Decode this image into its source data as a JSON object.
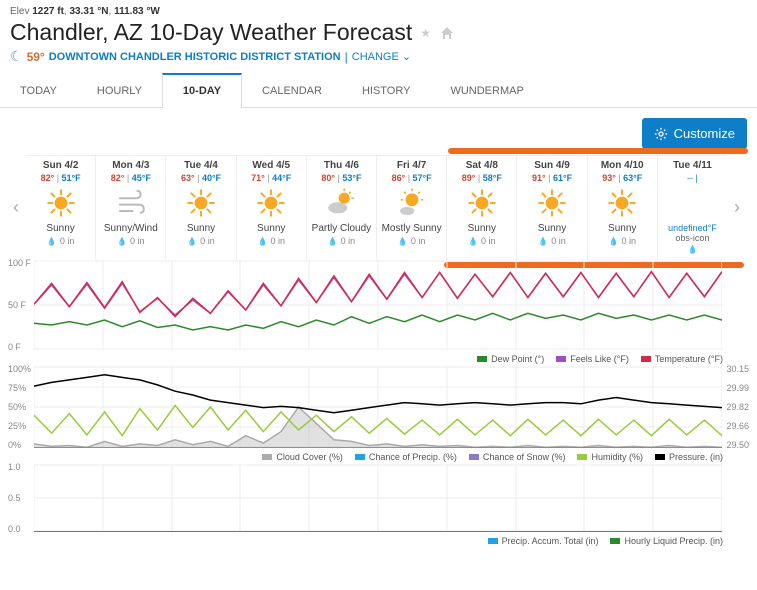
{
  "header": {
    "elev_label": "Elev",
    "elev": "1227 ft",
    "lat": "33.31 °N",
    "lon": "111.83 °W",
    "title": "Chandler, AZ 10-Day Weather Forecast",
    "current_temp": "59°",
    "station": "DOWNTOWN CHANDLER HISTORIC DISTRICT STATION",
    "change": "CHANGE"
  },
  "tabs": [
    "TODAY",
    "HOURLY",
    "10-DAY",
    "CALENDAR",
    "HISTORY",
    "WUNDERMAP"
  ],
  "active_tab": 2,
  "customize_label": "Customize",
  "days": [
    {
      "label": "Sun 4/2",
      "hi": "82°",
      "lo": "51°F",
      "icon": "sunny",
      "cond": "Sunny",
      "precip": "0 in"
    },
    {
      "label": "Mon 4/3",
      "hi": "82°",
      "lo": "45°F",
      "icon": "wind",
      "cond": "Sunny/Wind",
      "precip": "0 in"
    },
    {
      "label": "Tue 4/4",
      "hi": "63°",
      "lo": "40°F",
      "icon": "sunny",
      "cond": "Sunny",
      "precip": "0 in"
    },
    {
      "label": "Wed 4/5",
      "hi": "71°",
      "lo": "44°F",
      "icon": "sunny",
      "cond": "Sunny",
      "precip": "0 in"
    },
    {
      "label": "Thu 4/6",
      "hi": "80°",
      "lo": "53°F",
      "icon": "partly",
      "cond": "Partly Cloudy",
      "precip": "0 in"
    },
    {
      "label": "Fri 4/7",
      "hi": "86°",
      "lo": "57°F",
      "icon": "mostly",
      "cond": "Mostly Sunny",
      "precip": "0 in"
    },
    {
      "label": "Sat 4/8",
      "hi": "89°",
      "lo": "58°F",
      "icon": "sunny",
      "cond": "Sunny",
      "precip": "0 in"
    },
    {
      "label": "Sun 4/9",
      "hi": "91°",
      "lo": "61°F",
      "icon": "sunny",
      "cond": "Sunny",
      "precip": "0 in"
    },
    {
      "label": "Mon 4/10",
      "hi": "93°",
      "lo": "63°F",
      "icon": "sunny",
      "cond": "Sunny",
      "precip": "0 in"
    },
    {
      "label": "Tue 4/11",
      "hi": "--",
      "lo": "",
      "icon": "none",
      "cond": "obs-icon",
      "precip": "",
      "undefined": "undefined°F"
    }
  ],
  "chart_data": [
    {
      "type": "line",
      "ylabel_left": [
        "100 F",
        "50 F",
        "0 F"
      ],
      "series": [
        {
          "name": "Dew Point (°)",
          "color": "#2a8a2a",
          "values": [
            32,
            30,
            34,
            30,
            36,
            28,
            35,
            27,
            30,
            24,
            28,
            24,
            30,
            26,
            34,
            28,
            36,
            30,
            40,
            32,
            40,
            34,
            42,
            34,
            42,
            36,
            44,
            36,
            44,
            38,
            42,
            36,
            44,
            38,
            42,
            36,
            42,
            36,
            42,
            36
          ]
        },
        {
          "name": "Feels Like (°F)",
          "color": "#a050c0",
          "values": [
            55,
            78,
            52,
            79,
            50,
            80,
            46,
            62,
            42,
            60,
            44,
            70,
            48,
            78,
            53,
            84,
            57,
            87,
            58,
            89,
            61,
            91,
            63,
            93,
            62,
            91,
            64,
            93,
            63,
            92,
            64,
            93,
            63,
            92,
            64,
            94,
            63,
            92,
            64,
            94
          ]
        },
        {
          "name": "Temperature (°F)",
          "color": "#d6294a",
          "values": [
            55,
            80,
            52,
            81,
            51,
            82,
            45,
            63,
            40,
            62,
            44,
            71,
            48,
            80,
            53,
            86,
            57,
            89,
            58,
            91,
            61,
            93,
            63,
            93,
            62,
            91,
            64,
            93,
            63,
            92,
            64,
            93,
            63,
            92,
            64,
            94,
            63,
            92,
            64,
            94
          ]
        }
      ],
      "ylim": [
        0,
        108
      ]
    },
    {
      "type": "line",
      "ylabel_left": [
        "100%",
        "75%",
        "50%",
        "25%",
        "0%"
      ],
      "ylabel_right": [
        "30.15",
        "29.99",
        "29.82",
        "29.66",
        "29.50"
      ],
      "series": [
        {
          "name": "Cloud Cover (%)",
          "color": "#aaa",
          "area": true,
          "values": [
            5,
            2,
            3,
            1,
            8,
            2,
            5,
            3,
            10,
            4,
            8,
            2,
            15,
            6,
            20,
            50,
            30,
            10,
            8,
            3,
            5,
            2,
            4,
            2,
            3,
            1,
            2,
            1,
            3,
            1,
            2,
            1,
            3,
            1,
            2,
            1,
            3,
            1,
            2,
            1
          ]
        },
        {
          "name": "Chance of Precip. (%)",
          "color": "#1fa3e6",
          "values": [
            0,
            0,
            0,
            0,
            0,
            0,
            0,
            0,
            0,
            0,
            0,
            0,
            0,
            0,
            0,
            0,
            0,
            0,
            0,
            0,
            0,
            0,
            0,
            0,
            0,
            0,
            0,
            0,
            0,
            0,
            0,
            0,
            0,
            0,
            0,
            0,
            0,
            0,
            0,
            0
          ]
        },
        {
          "name": "Chance of Snow (%)",
          "color": "#8a7ac7",
          "values": [
            0,
            0,
            0,
            0,
            0,
            0,
            0,
            0,
            0,
            0,
            0,
            0,
            0,
            0,
            0,
            0,
            0,
            0,
            0,
            0,
            0,
            0,
            0,
            0,
            0,
            0,
            0,
            0,
            0,
            0,
            0,
            0,
            0,
            0,
            0,
            0,
            0,
            0,
            0,
            0
          ]
        },
        {
          "name": "Humidity (%)",
          "color": "#9acb3c",
          "values": [
            40,
            18,
            42,
            16,
            44,
            15,
            48,
            22,
            52,
            25,
            50,
            22,
            46,
            20,
            44,
            22,
            40,
            20,
            38,
            18,
            36,
            17,
            34,
            16,
            35,
            16,
            34,
            15,
            35,
            16,
            34,
            15,
            35,
            16,
            34,
            15,
            35,
            16,
            34,
            15
          ]
        },
        {
          "name": "Pressure. (in)",
          "color": "#000",
          "axis": "right",
          "values": [
            29.99,
            30.02,
            30.04,
            30.06,
            30.08,
            30.06,
            30.04,
            30.0,
            29.95,
            29.92,
            29.88,
            29.86,
            29.84,
            29.82,
            29.83,
            29.82,
            29.8,
            29.78,
            29.8,
            29.82,
            29.84,
            29.86,
            29.85,
            29.84,
            29.85,
            29.86,
            29.85,
            29.84,
            29.85,
            29.86,
            29.86,
            29.85,
            29.88,
            29.9,
            29.88,
            29.86,
            29.85,
            29.84,
            29.83,
            29.82
          ]
        }
      ],
      "ylim_left": [
        0,
        100
      ],
      "ylim_right": [
        29.5,
        30.15
      ]
    },
    {
      "type": "line",
      "ylabel_left": [
        "1.0",
        "0.5",
        "0.0"
      ],
      "series": [
        {
          "name": "Precip. Accum. Total (in)",
          "color": "#1fa3e6",
          "values": [
            0,
            0,
            0,
            0,
            0,
            0,
            0,
            0,
            0,
            0,
            0,
            0,
            0,
            0,
            0,
            0,
            0,
            0,
            0,
            0,
            0,
            0,
            0,
            0,
            0,
            0,
            0,
            0,
            0,
            0,
            0,
            0,
            0,
            0,
            0,
            0,
            0,
            0,
            0,
            0
          ]
        },
        {
          "name": "Hourly Liquid Precip. (in)",
          "color": "#2a8a2a",
          "values": [
            0,
            0,
            0,
            0,
            0,
            0,
            0,
            0,
            0,
            0,
            0,
            0,
            0,
            0,
            0,
            0,
            0,
            0,
            0,
            0,
            0,
            0,
            0,
            0,
            0,
            0,
            0,
            0,
            0,
            0,
            0,
            0,
            0,
            0,
            0,
            0,
            0,
            0,
            0,
            0
          ]
        }
      ],
      "ylim": [
        0,
        1
      ]
    }
  ]
}
